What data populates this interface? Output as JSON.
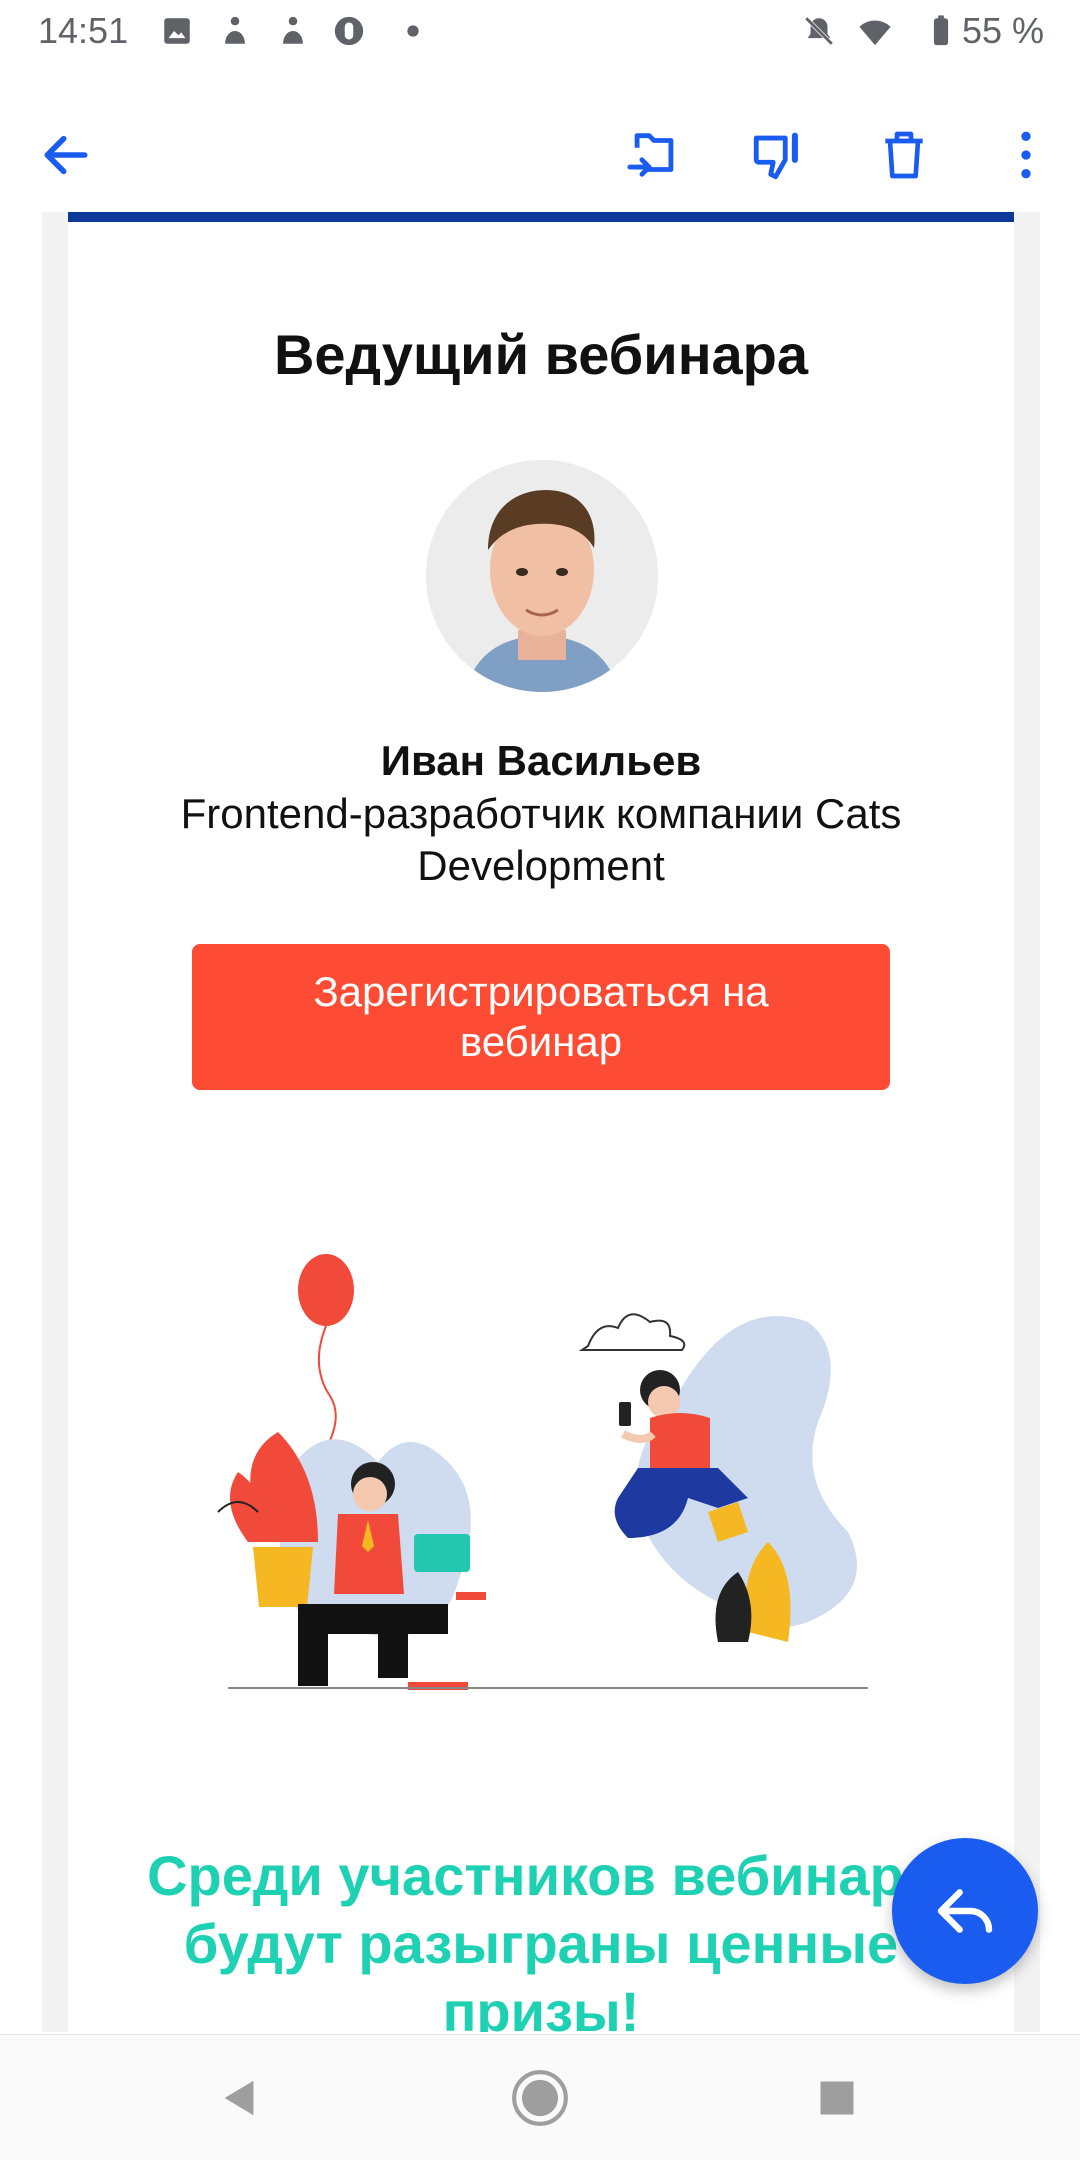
{
  "status_bar": {
    "time": "14:51",
    "battery_text": "55 %",
    "icons": [
      "image-icon",
      "app-icon",
      "app-icon",
      "app-icon",
      "dot-icon",
      "mute-icon",
      "wifi-icon",
      "battery-icon"
    ]
  },
  "toolbar": {
    "back_icon": "arrow-left-icon",
    "move_icon": "move-to-folder-icon",
    "dislike_icon": "thumb-down-icon",
    "delete_icon": "trash-icon",
    "more_icon": "more-vertical-icon"
  },
  "email": {
    "section_title": "Ведущий вебинара",
    "host_name": "Иван Васильев",
    "host_role": "Frontend-разработчик компании Cats Development",
    "register_button": "Зарегистрироваться на вебинар",
    "prizes_text": "Среди участников вебинара будут разыграны ценные призы!"
  },
  "fab": {
    "icon": "reply-icon"
  },
  "nav_bar": {
    "back": "back-triangle-icon",
    "home": "home-circle-icon",
    "recents": "recents-square-icon"
  },
  "colors": {
    "accent_blue": "#1a5cf0",
    "top_rule": "#0d3a99",
    "register_bg": "#fd4c33",
    "prizes_text": "#1fd1b3"
  }
}
